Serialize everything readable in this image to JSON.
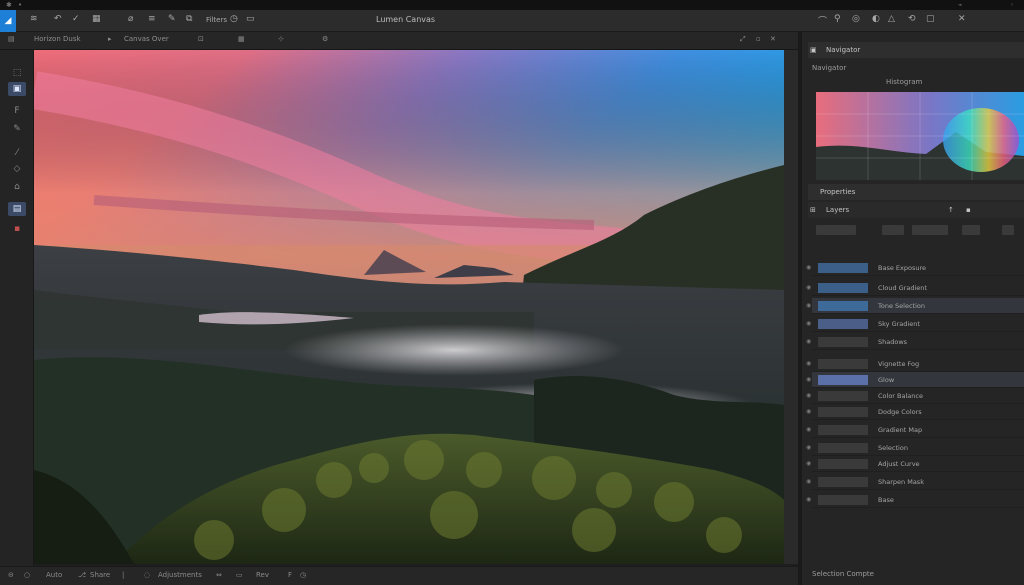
{
  "menubar": {
    "title": "Lumen Canvas"
  },
  "tabs": {
    "doc": "Horizon Dusk",
    "view": "Canvas Over"
  },
  "panel": {
    "navigator_title": "Navigator",
    "navigator_sub": "Navigator",
    "histogram_label": "Histogram",
    "layers_title": "Layers",
    "properties_label": "Properties",
    "layer_names": [
      "Base Exposure",
      "Cloud Gradient",
      "Tone Selection",
      "Sky Gradient",
      "Shadows",
      "Vignette Fog",
      "Glow",
      "Color Balance",
      "Dodge Colors",
      "Gradient Map",
      "Selection",
      "Adjust Curve",
      "Sharpen Mask",
      "Base"
    ]
  },
  "statusbar": {
    "zoom": "Auto",
    "info": "Share",
    "doc": "Adjustments",
    "pos": "Rev",
    "right": "Selection Compte"
  },
  "colors": {
    "accent": "#1d7fd6",
    "panel_bg": "#252525",
    "canvas_bg": "#3a3a3a"
  }
}
